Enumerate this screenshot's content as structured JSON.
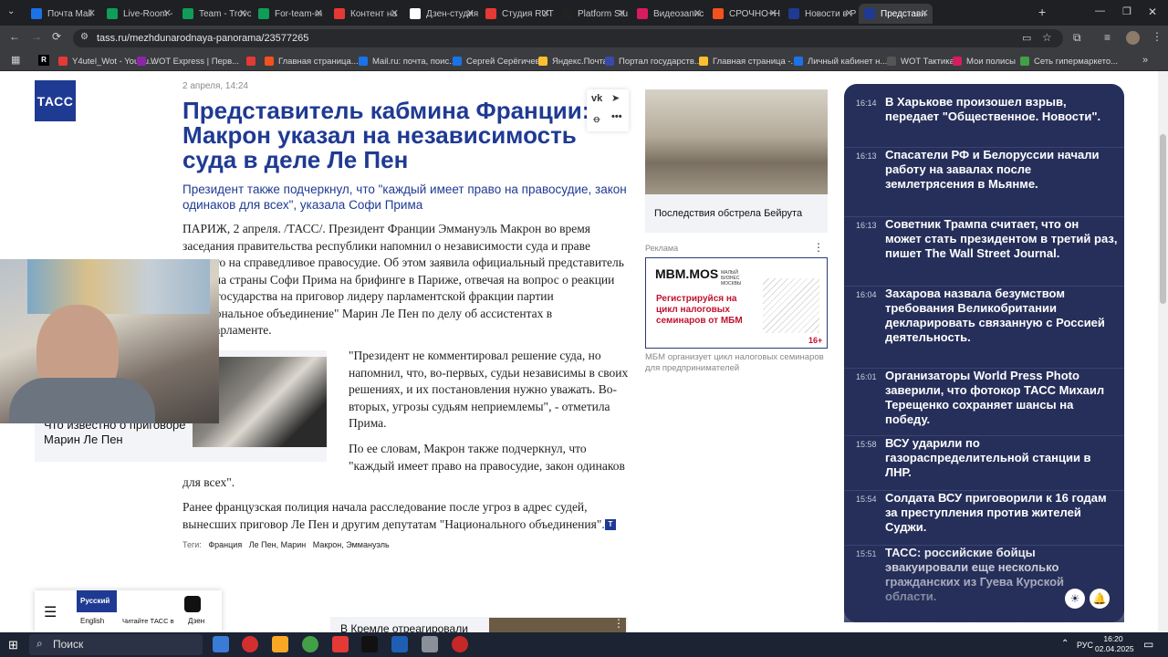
{
  "browser": {
    "tabs": [
      {
        "label": "Почта Mail",
        "color": "#1a73e8"
      },
      {
        "label": "Live-Room -",
        "color": "#0f9d58"
      },
      {
        "label": "Team - Trovo",
        "color": "#0f9d58"
      },
      {
        "label": "For-team-m",
        "color": "#0f9d58"
      },
      {
        "label": "Контент на",
        "color": "#e53935"
      },
      {
        "label": "Дзен-студия",
        "color": "#ffffff"
      },
      {
        "label": "Студия RUTI",
        "color": "#e53935"
      },
      {
        "label": "Platform Stu",
        "color": "#222222"
      },
      {
        "label": "Видеозапис",
        "color": "#d81b60"
      },
      {
        "label": "СРОЧНО+Н",
        "color": "#f4511e"
      },
      {
        "label": "Новости в Р",
        "color": "#1f3a93"
      },
      {
        "label": "Представи",
        "color": "#1f3a93"
      }
    ],
    "url": "tass.ru/mezhdunarodnaya-panorama/23577265",
    "bookmarks": [
      {
        "label": "Y4utel_Wot - YouTu...",
        "color": "#e53935"
      },
      {
        "label": "WOT Express | Перв...",
        "color": "#8e24aa"
      },
      {
        "label": "",
        "color": "#e53935"
      },
      {
        "label": "Главная страница...",
        "color": "#f4511e"
      },
      {
        "label": "Mail.ru: почта, поис...",
        "color": "#1a73e8"
      },
      {
        "label": "Сергей Серёгичев",
        "color": "#1a73e8"
      },
      {
        "label": "Яндекс.Почта",
        "color": "#fbc02d"
      },
      {
        "label": "Портал государств...",
        "color": "#3949ab"
      },
      {
        "label": "Главная страница -...",
        "color": "#fbc02d"
      },
      {
        "label": "Личный кабинет н...",
        "color": "#1a73e8"
      },
      {
        "label": "WOT Тактика",
        "color": "#555555"
      },
      {
        "label": "Мои полисы",
        "color": "#d81b60"
      },
      {
        "label": "Сеть гипермаркето...",
        "color": "#43a047"
      }
    ]
  },
  "article": {
    "logo": "ТАСС",
    "date": "2 апреля, 14:24",
    "title": "Представитель кабмина Франции: Макрон указал на независимость суда в деле Ле Пен",
    "lead": "Президент также подчеркнул, что \"каждый имеет право на правосудие, закон одинаков для всех\", указала Софи Прима",
    "p1_lines": [
      "ПАРИЖ, 2 апреля. /ТАСС/. Президент Франции Эммануэль Макрон во время",
      "заседания правительства республики напомнил о независимости суда и праве",
      "каждого на справедливое правосудие. Об этом заявила официальный представитель",
      "кабмина страны Софи Прима на брифинге в Париже, отвечая на вопрос о реакции",
      "главы государства на приговор лидеру парламентской фракции партии",
      "\"Национальное объединение\" Марин Ле Пен по делу об ассистентах в",
      "Европарламенте."
    ],
    "p2_lines": [
      "\"Президент не комментировал решение суда, но",
      "напомнил, что, во-первых, судьи независимы в своих",
      "решениях, и их постановления нужно уважать. Во-",
      "вторых, угрозы судьям неприемлемы\", - отметила",
      "Прима."
    ],
    "p3_lines": [
      "По ее словам, Макрон также подчеркнул, что",
      "\"каждый имеет право на правосудие, закон одинаков"
    ],
    "p3_tail": "для всех\".",
    "p4_lines": [
      "Ранее французская полиция начала расследование после угроз в адрес судей,",
      "вынесших приговор Ле Пен и другим депутатам \"Национального объединения\"."
    ],
    "tass_mark": "Т",
    "related_title": "Что известно о приговоре Марин Ле Пен",
    "tags_label": "Теги:",
    "tags": [
      "Франция",
      "Ле Пен, Марин",
      "Макрон, Эммануэль"
    ]
  },
  "sidebar": {
    "photo_caption": "Последствия обстрела Бейрута",
    "ad_label": "Реклама",
    "ad_brand": "MBM.MOS",
    "ad_brand_sub": "МАЛЫЙ БИЗНЕС МОСКВЫ",
    "ad_text": "Регистрируйся на цикл налоговых семинаров от МБМ",
    "ad_age": "16+",
    "ad_caption": "МБМ организует цикл налоговых семинаров для предпринимателей"
  },
  "news": [
    {
      "time": "16:14",
      "text": "В Харькове произошел взрыв, передает \"Общественное. Новости\"."
    },
    {
      "time": "16:13",
      "text": "Спасатели РФ и Белоруссии начали работу на завалах после землетрясения в Мьянме."
    },
    {
      "time": "16:13",
      "text": "Советник Трампа считает, что он может стать президентом в третий раз, пишет The Wall Street Journal."
    },
    {
      "time": "16:04",
      "text": "Захарова назвала безумством требования Великобритании декларировать связанную с Россией деятельность."
    },
    {
      "time": "16:01",
      "text": "Организаторы World Press Photo заверили, что фотокор ТАСС Михаил Терещенко сохраняет шансы на победу."
    },
    {
      "time": "15:58",
      "text": "ВСУ ударили по газораспределительной станции в ЛНР."
    },
    {
      "time": "15:54",
      "text": "Солдата ВСУ приговорили к 16 годам за преступления против жителей Суджи."
    },
    {
      "time": "15:51",
      "text": "ТАСС: российские бойцы эвакуировали еще несколько гражданских из Гуева Курской области."
    }
  ],
  "bottom_nav": {
    "lang_ru": "Русский",
    "lang_en": "English",
    "read_tass": "Читайте ТАСС в",
    "dzen": "Дзен"
  },
  "bottom_card": "В Кремле отреагировали",
  "taskbar": {
    "search": "Поиск",
    "lang": "РУС",
    "time": "16:20",
    "date": "02.04.2025"
  }
}
